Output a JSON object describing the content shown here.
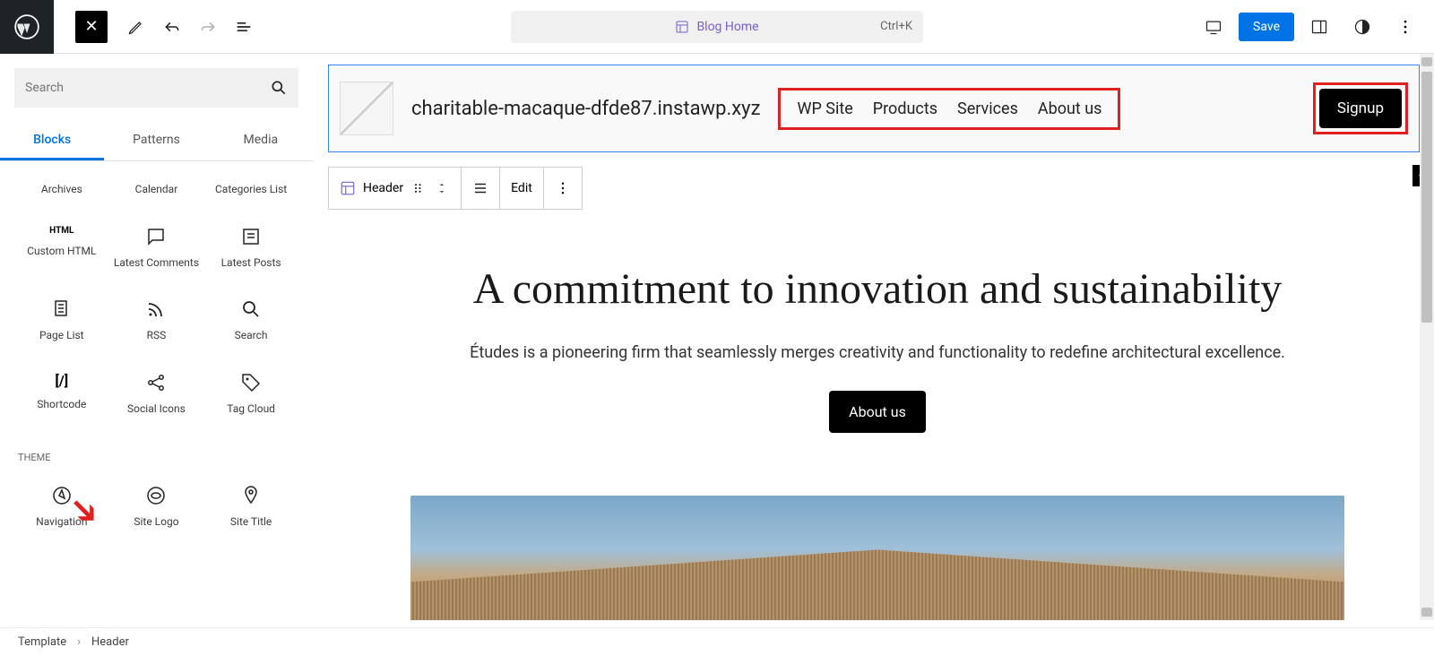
{
  "topbar": {
    "command_label": "Blog Home",
    "shortcut": "Ctrl+K",
    "save": "Save"
  },
  "sidebar": {
    "search_placeholder": "Search",
    "tabs": [
      "Blocks",
      "Patterns",
      "Media"
    ],
    "active_tab": 0,
    "blocks_group1": [
      {
        "label": "Archives",
        "icon": "archives"
      },
      {
        "label": "Calendar",
        "icon": "calendar"
      },
      {
        "label": "Categories List",
        "icon": "categories"
      }
    ],
    "blocks_group2": [
      {
        "label": "Custom HTML",
        "icon": "html"
      },
      {
        "label": "Latest Comments",
        "icon": "comments"
      },
      {
        "label": "Latest Posts",
        "icon": "posts"
      }
    ],
    "blocks_group3": [
      {
        "label": "Page List",
        "icon": "pagelist"
      },
      {
        "label": "RSS",
        "icon": "rss"
      },
      {
        "label": "Search",
        "icon": "search"
      }
    ],
    "blocks_group4": [
      {
        "label": "Shortcode",
        "icon": "shortcode"
      },
      {
        "label": "Social Icons",
        "icon": "social"
      },
      {
        "label": "Tag Cloud",
        "icon": "tag"
      }
    ],
    "theme_label": "THEME",
    "theme_blocks": [
      {
        "label": "Navigation",
        "icon": "navigation"
      },
      {
        "label": "Site Logo",
        "icon": "sitelogo"
      },
      {
        "label": "Site Title",
        "icon": "sitetitle"
      }
    ]
  },
  "canvas": {
    "site_title": "charitable-macaque-dfde87.instawp.xyz",
    "nav_items": [
      "WP Site",
      "Products",
      "Services",
      "About us"
    ],
    "signup": "Signup",
    "toolbar_block": "Header",
    "toolbar_edit": "Edit",
    "hero_heading": "A commitment to innovation and sustainability",
    "hero_sub": "Études is a pioneering firm that seamlessly merges creativity and functionality to redefine architectural excellence.",
    "hero_cta": "About us"
  },
  "breadcrumb": {
    "root": "Template",
    "current": "Header"
  }
}
